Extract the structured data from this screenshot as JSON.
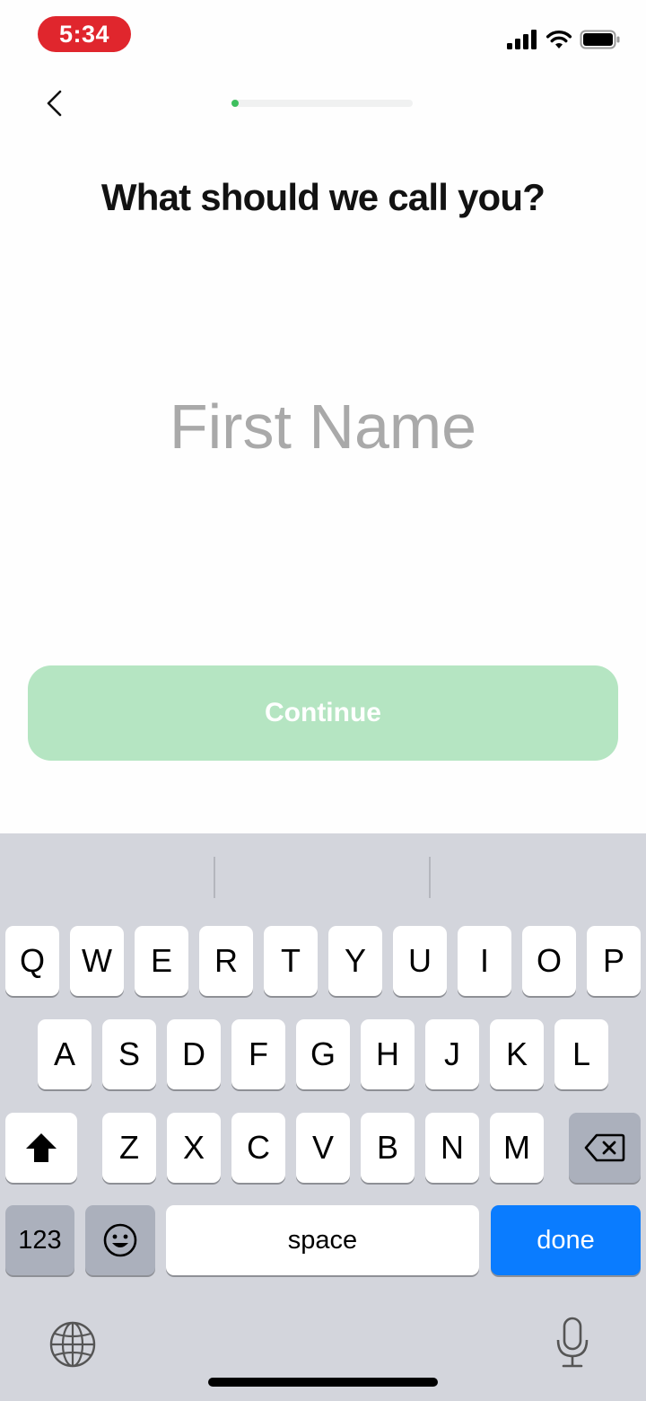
{
  "status_bar": {
    "time": "5:34"
  },
  "onboarding": {
    "progress_fraction": 0.04,
    "heading": "What should we call you?",
    "name_input": {
      "placeholder": "First Name",
      "value": ""
    },
    "continue_label": "Continue"
  },
  "colors": {
    "accent_green": "#3ebf5e",
    "continue_disabled": "#b5e5c2",
    "keyboard_done": "#0a7cff"
  },
  "keyboard": {
    "row1": [
      "Q",
      "W",
      "E",
      "R",
      "T",
      "Y",
      "U",
      "I",
      "O",
      "P"
    ],
    "row2": [
      "A",
      "S",
      "D",
      "F",
      "G",
      "H",
      "J",
      "K",
      "L"
    ],
    "row3": [
      "Z",
      "X",
      "C",
      "V",
      "B",
      "N",
      "M"
    ],
    "numbers_label": "123",
    "space_label": "space",
    "done_label": "done",
    "icons": {
      "shift": "shift-icon",
      "backspace": "backspace-icon",
      "emoji": "emoji-icon",
      "globe": "globe-icon",
      "mic": "microphone-icon"
    }
  }
}
